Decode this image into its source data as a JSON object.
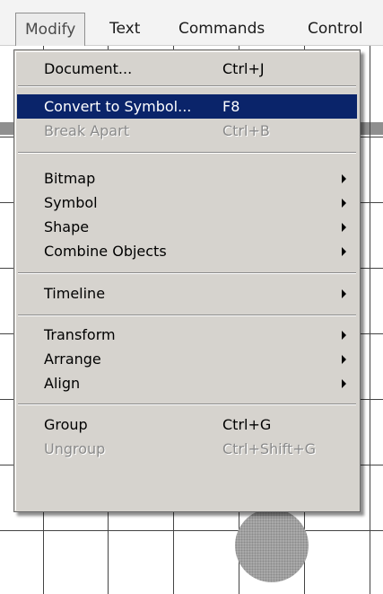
{
  "menubar": {
    "items": [
      {
        "label": "Modify"
      },
      {
        "label": "Text"
      },
      {
        "label": "Commands"
      },
      {
        "label": "Control"
      }
    ]
  },
  "menu": {
    "items": [
      {
        "label": "Document...",
        "shortcut": "Ctrl+J"
      },
      {
        "label": "Convert to Symbol...",
        "shortcut": "F8"
      },
      {
        "label": "Break Apart",
        "shortcut": "Ctrl+B"
      },
      {
        "label": "Bitmap"
      },
      {
        "label": "Symbol"
      },
      {
        "label": "Shape"
      },
      {
        "label": "Combine Objects"
      },
      {
        "label": "Timeline"
      },
      {
        "label": "Transform"
      },
      {
        "label": "Arrange"
      },
      {
        "label": "Align"
      },
      {
        "label": "Group",
        "shortcut": "Ctrl+G"
      },
      {
        "label": "Ungroup",
        "shortcut": "Ctrl+Shift+G"
      }
    ]
  },
  "colors": {
    "menu_bg": "#d6d3ce",
    "highlight": "#0a246a",
    "disabled_text": "#8a8a8a"
  }
}
